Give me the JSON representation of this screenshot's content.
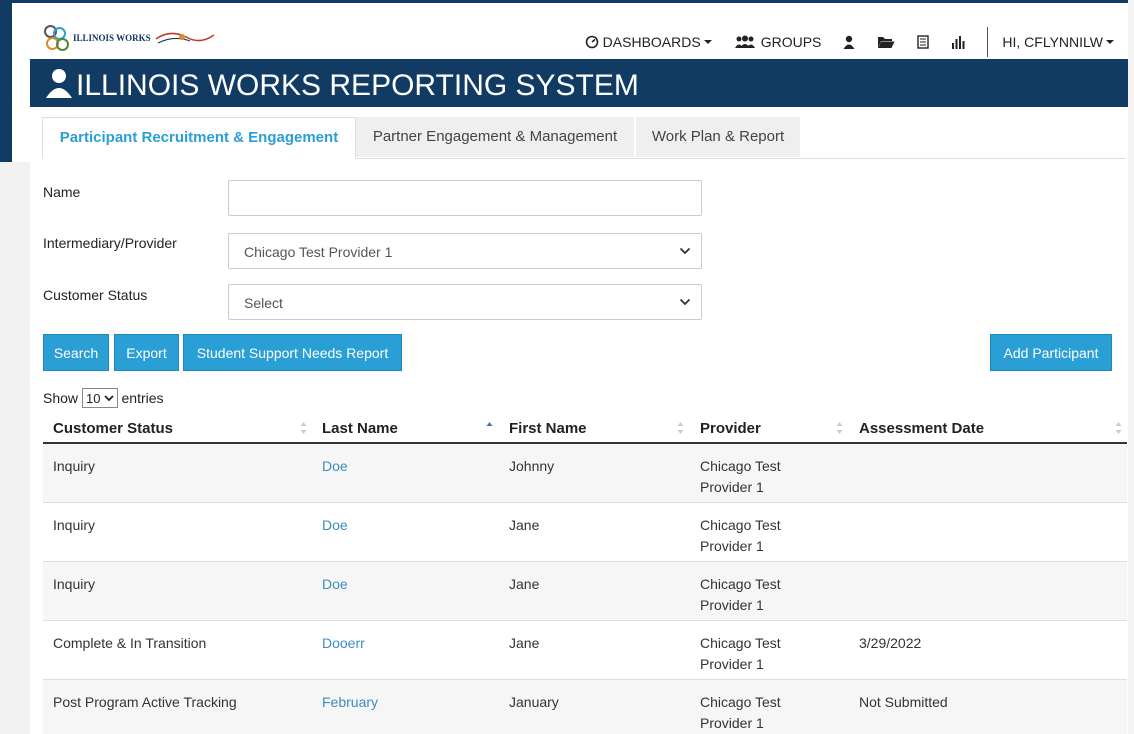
{
  "colors": {
    "primary": "#2a9fd6",
    "navy": "#123b63",
    "link": "#3c8dbc"
  },
  "nav": {
    "logo_text": "ILLINOIS WORKS",
    "dashboards": "DASHBOARDS",
    "groups": "GROUPS",
    "user_greeting": "HI, CFLYNNILW"
  },
  "banner": {
    "title": "ILLINOIS WORKS REPORTING SYSTEM"
  },
  "tabs": [
    {
      "label": "Participant Recruitment & Engagement",
      "active": true
    },
    {
      "label": "Partner Engagement & Management",
      "active": false
    },
    {
      "label": "Work Plan & Report",
      "active": false
    }
  ],
  "form": {
    "name_label": "Name",
    "name_value": "",
    "provider_label": "Intermediary/Provider",
    "provider_value": "Chicago Test Provider 1",
    "status_label": "Customer Status",
    "status_value": "Select"
  },
  "buttons": {
    "search": "Search",
    "export": "Export",
    "support": "Student Support Needs Report",
    "add": "Add Participant"
  },
  "entries": {
    "show": "Show",
    "value": "10",
    "suffix": "entries"
  },
  "table": {
    "headers": [
      "Customer Status",
      "Last Name",
      "First Name",
      "Provider",
      "Assessment Date"
    ],
    "rows": [
      {
        "status": "Inquiry",
        "last": "Doe",
        "first": "Johnny",
        "provider1": "Chicago Test",
        "provider2": "Provider 1",
        "date": ""
      },
      {
        "status": "Inquiry",
        "last": "Doe",
        "first": "Jane",
        "provider1": "Chicago Test",
        "provider2": "Provider 1",
        "date": ""
      },
      {
        "status": "Inquiry",
        "last": "Doe",
        "first": "Jane",
        "provider1": "Chicago Test",
        "provider2": "Provider 1",
        "date": ""
      },
      {
        "status": "Complete & In Transition",
        "last": "Dooerr",
        "first": "Jane",
        "provider1": "Chicago Test",
        "provider2": "Provider 1",
        "date": "3/29/2022"
      },
      {
        "status": "Post Program Active Tracking",
        "last": "February",
        "first": "January",
        "provider1": "Chicago Test",
        "provider2": "Provider 1",
        "date": "Not Submitted"
      }
    ]
  }
}
